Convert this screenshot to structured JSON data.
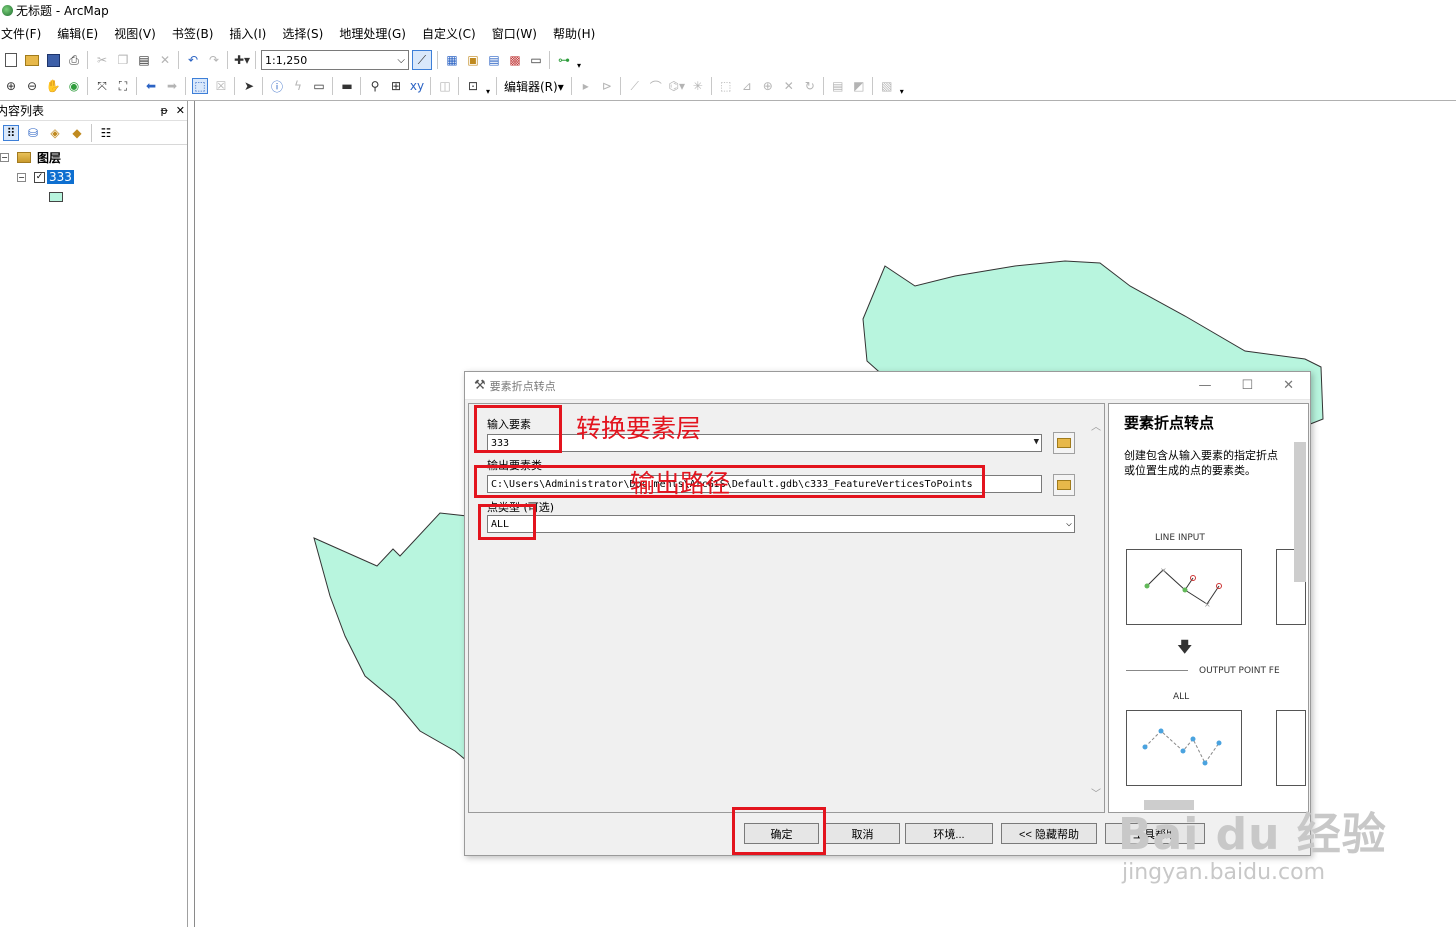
{
  "window": {
    "title": "无标题 - ArcMap"
  },
  "menu": [
    "文件(F)",
    "编辑(E)",
    "视图(V)",
    "书签(B)",
    "插入(I)",
    "选择(S)",
    "地理处理(G)",
    "自定义(C)",
    "窗口(W)",
    "帮助(H)"
  ],
  "toolbar": {
    "scale": "1:1,250",
    "editor_menu": "编辑器(R)▾"
  },
  "toc": {
    "title": "内容列表",
    "pin": "ᵽ",
    "close": "✕",
    "root_label": "图层",
    "layer_name": "333"
  },
  "dialog": {
    "title": "要素折点转点",
    "input_label": "输入要素",
    "input_value": "333",
    "output_label": "输出要素类",
    "output_value": "C:\\Users\\Administrator\\Documents\\ArcGIS\\Default.gdb\\c333_FeatureVerticesToPoints",
    "type_label": "点类型 (可选)",
    "type_value": "ALL",
    "ok_label": "确定",
    "cancel_label": "取消",
    "env_label": "环境...",
    "hide_help_label": "<< 隐藏帮助",
    "tool_help_label": "工具帮助",
    "help": {
      "title": "要素折点转点",
      "desc": "创建包含从输入要素的指定折点或位置生成的点的要素类。",
      "line_input": "LINE INPUT",
      "output_point": "OUTPUT POINT FE",
      "all": "ALL"
    }
  },
  "annotations": {
    "input_note": "转换要素层",
    "output_note": "输出路径",
    "color": "#e3141e"
  },
  "watermark": {
    "brand": "Bai du 经验",
    "url": "jingyan.baidu.com"
  },
  "colors": {
    "polygon_fill": "#b8f5de",
    "selection": "#0e6fd0"
  }
}
